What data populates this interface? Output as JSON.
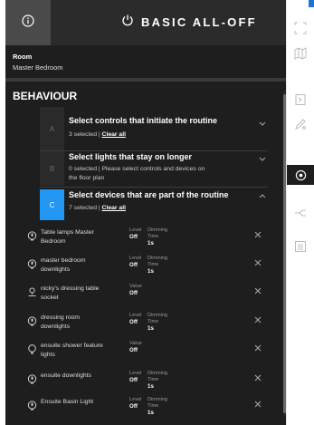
{
  "header": {
    "title": "BASIC ALL-OFF",
    "info_icon": "info-icon",
    "power_icon": "power-icon"
  },
  "room": {
    "label": "Room",
    "value": "Master Bedroom"
  },
  "behaviour": {
    "heading": "BEHAVIOUR",
    "sections": [
      {
        "letter": "A",
        "title": "Select controls that initiate the routine",
        "subtitle_prefix": "3 selected | ",
        "clear": "Clear all",
        "expanded": false
      },
      {
        "letter": "B",
        "title": "Select lights that stay on longer",
        "subtitle_line1": "0 selected | Please select controls and devices on",
        "subtitle_line2": "the floor plan",
        "expanded": false
      },
      {
        "letter": "C",
        "title": "Select devices that are part of the routine",
        "subtitle_prefix": "7 selected | ",
        "clear": "Clear all",
        "expanded": true
      }
    ]
  },
  "devices": [
    {
      "name_line1": "Table lamps Master",
      "name_line2": "Bedroom",
      "icon": "bulb-icon",
      "c1_label": "Level",
      "c1_value": "Off",
      "c2_label1": "Dimming",
      "c2_label2": "Time",
      "c2_value": "1s"
    },
    {
      "name_line1": "master bedroom",
      "name_line2": "downlights",
      "icon": "bulb-icon",
      "c1_label": "Level",
      "c1_value": "Off",
      "c2_label1": "Dimming",
      "c2_label2": "Time",
      "c2_value": "1s"
    },
    {
      "name_line1": "nicky's dressing table",
      "name_line2": "socket",
      "icon": "socket-icon",
      "c1_label": "Value",
      "c1_value": "Off"
    },
    {
      "name_line1": "dressing room",
      "name_line2": "downlights",
      "icon": "bulb-icon",
      "c1_label": "Level",
      "c1_value": "Off",
      "c2_label1": "Dimming",
      "c2_label2": "Time",
      "c2_value": "1s"
    },
    {
      "name_line1": "ensuite shower feature",
      "name_line2": "lights",
      "icon": "bulb-outline-icon",
      "c1_label": "Value",
      "c1_value": "Off"
    },
    {
      "name_line1": "ensuite downlights",
      "name_line2": "",
      "icon": "bulb-icon",
      "c1_label": "Level",
      "c1_value": "Off",
      "c2_label1": "Dimming",
      "c2_label2": "Time",
      "c2_value": "1s"
    },
    {
      "name_line1": "Ensuite Basin Light",
      "name_line2": "",
      "icon": "bulb-icon",
      "c1_label": "Level",
      "c1_value": "Off",
      "c2_label1": "Dimming",
      "c2_label2": "Time",
      "c2_value": "1s"
    }
  ],
  "sidebar": {
    "icons": [
      "expand-icon",
      "map-icon",
      "login-icon",
      "edit-icon",
      "target-icon",
      "split-icon",
      "list-icon"
    ]
  },
  "colors": {
    "panel_bg": "#1e1e1e",
    "header_bg": "#2b2b2b",
    "accent": "#2196f3"
  }
}
